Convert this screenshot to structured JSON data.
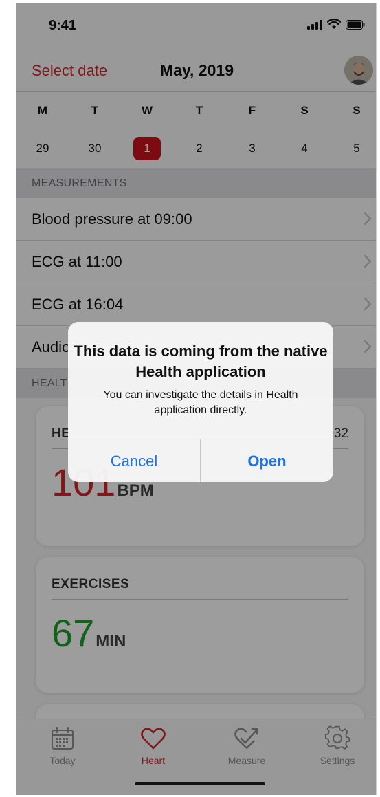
{
  "status_bar": {
    "time": "9:41"
  },
  "nav": {
    "select_date_label": "Select date",
    "title": "May, 2019"
  },
  "week": {
    "weekdays": [
      "M",
      "T",
      "W",
      "T",
      "F",
      "S",
      "S"
    ],
    "days": [
      "29",
      "30",
      "1",
      "2",
      "3",
      "4",
      "5"
    ],
    "selected_index": 2
  },
  "measurements": {
    "header": "MEASUREMENTS",
    "rows": [
      {
        "label": "Blood pressure at 09:00"
      },
      {
        "label": "ECG at 11:00"
      },
      {
        "label": "ECG at 16:04"
      },
      {
        "label": "Audio"
      }
    ]
  },
  "health": {
    "header": "HEALT",
    "heart_card": {
      "title": "HE",
      "side_value": "32",
      "value": "101",
      "unit": "BPM",
      "value_color": "#d1242c"
    },
    "exercises_card": {
      "title": "EXERCISES",
      "value": "67",
      "unit": "MIN",
      "value_color": "#1f9d2b"
    }
  },
  "tabbar": {
    "tabs": [
      {
        "label": "Today",
        "icon": "calendar-icon"
      },
      {
        "label": "Heart",
        "icon": "heart-icon"
      },
      {
        "label": "Measure",
        "icon": "heart-check-icon"
      },
      {
        "label": "Settings",
        "icon": "gear-icon"
      }
    ],
    "active_index": 1
  },
  "alert": {
    "title": "This data is coming from the native Health application",
    "message": "You can investigate the details in Health application directly.",
    "cancel_label": "Cancel",
    "open_label": "Open"
  },
  "colors": {
    "accent_red": "#d1242c",
    "link_blue": "#1a73e8",
    "exercise_green": "#1f9d2b"
  }
}
